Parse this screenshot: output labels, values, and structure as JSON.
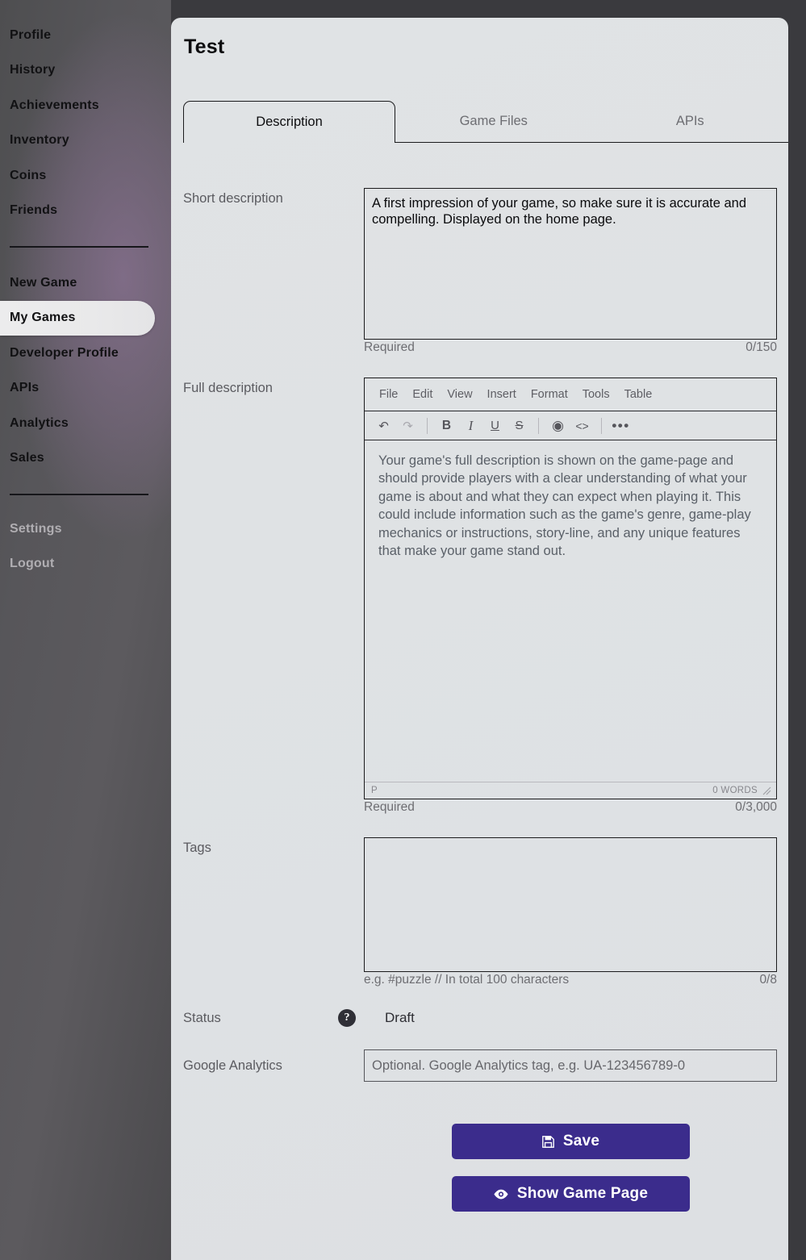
{
  "sidebar": {
    "group_one": [
      {
        "label": "Profile"
      },
      {
        "label": "History"
      },
      {
        "label": "Achievements"
      },
      {
        "label": "Inventory"
      },
      {
        "label": "Coins"
      },
      {
        "label": "Friends"
      }
    ],
    "group_two": [
      {
        "label": "New Game",
        "active": false
      },
      {
        "label": "My Games",
        "active": true
      },
      {
        "label": "Developer Profile",
        "active": false
      },
      {
        "label": "APIs",
        "active": false
      },
      {
        "label": "Analytics",
        "active": false
      },
      {
        "label": "Sales",
        "active": false
      }
    ],
    "group_three": [
      {
        "label": "Settings"
      },
      {
        "label": "Logout"
      }
    ]
  },
  "header": {
    "title": "Test"
  },
  "tabs": [
    {
      "label": "Description",
      "active": true
    },
    {
      "label": "Game Files",
      "active": false
    },
    {
      "label": "APIs",
      "active": false
    }
  ],
  "form": {
    "short_description": {
      "label": "Short description",
      "placeholder": "A first impression of your game, so make sure it is accurate and compelling. Displayed on the home page.",
      "value": "",
      "hint_left": "Required",
      "hint_right": "0/150"
    },
    "full_description": {
      "label": "Full description",
      "menubar": [
        "File",
        "Edit",
        "View",
        "Insert",
        "Format",
        "Tools",
        "Table"
      ],
      "toolbar": [
        {
          "name": "undo-icon",
          "glyph": "↶",
          "disabled": false
        },
        {
          "name": "redo-icon",
          "glyph": "↷",
          "disabled": true
        },
        {
          "name": "bold-icon",
          "glyph": "B",
          "disabled": false
        },
        {
          "name": "italic-icon",
          "glyph": "I",
          "disabled": false
        },
        {
          "name": "underline-icon",
          "glyph": "U",
          "disabled": false
        },
        {
          "name": "strikethrough-icon",
          "glyph": "S",
          "disabled": false
        },
        {
          "name": "preview-eye-icon",
          "glyph": "◉",
          "disabled": false
        },
        {
          "name": "source-code-icon",
          "glyph": "<>",
          "disabled": false
        },
        {
          "name": "more-options-icon",
          "glyph": "•••",
          "disabled": false
        }
      ],
      "placeholder": "Your game's full description is shown on the game-page and should provide players with a clear understanding of what your game is about and what they can expect when playing it. This could include information such as the game's genre, game-play mechanics or instructions, story-line, and any unique features that make your game stand out.",
      "status_left": "P",
      "status_right": "0 WORDS",
      "hint_left": "Required",
      "hint_right": "0/3,000"
    },
    "tags": {
      "label": "Tags",
      "value": "",
      "hint_left": "e.g. #puzzle // In total 100 characters",
      "hint_right": "0/8"
    },
    "status": {
      "label": "Status",
      "help_glyph": "?",
      "value": "Draft"
    },
    "google_analytics": {
      "label": "Google Analytics",
      "placeholder": "Optional. Google Analytics tag, e.g. UA-123456789-0",
      "value": ""
    }
  },
  "actions": {
    "save_label": "Save",
    "show_game_page_label": "Show Game Page"
  },
  "colors": {
    "accent_purple": "#3b2c8c",
    "panel_bg": "#dfe2e4",
    "page_bg": "#3a3a3e",
    "active_nav_bg": "#e9e9ea",
    "muted_text": "#6e6e73"
  }
}
